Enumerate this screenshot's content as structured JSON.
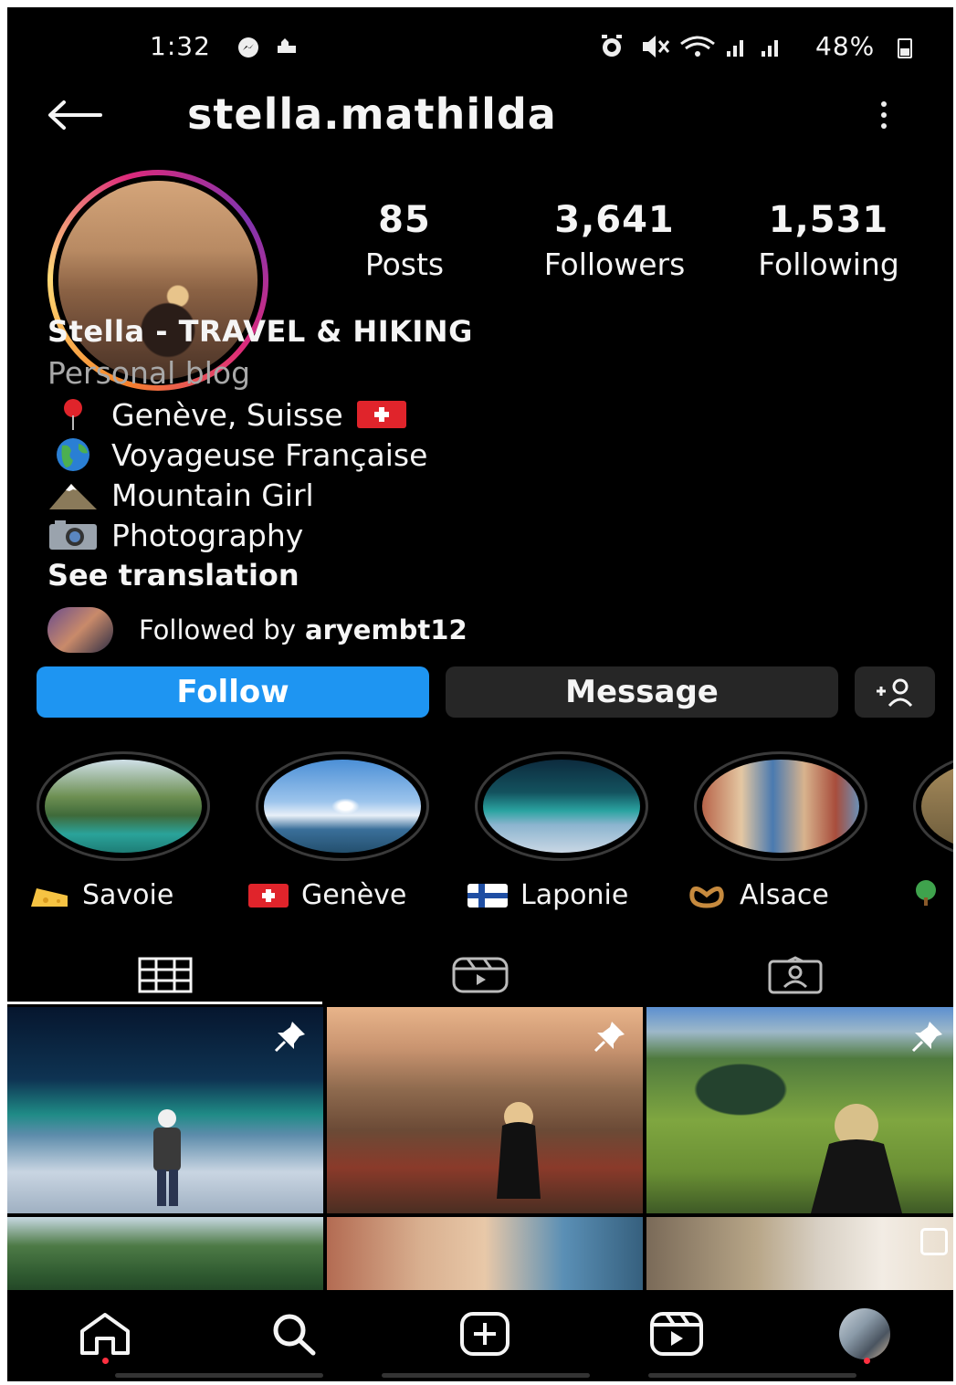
{
  "status_bar": {
    "time": "1:32",
    "battery": "48%",
    "icons": [
      "messenger-icon",
      "notification-icon",
      "alarm-icon",
      "mute-icon",
      "wifi-icon",
      "signal-icon",
      "signal-icon",
      "battery-icon"
    ]
  },
  "header": {
    "username": "stella.mathilda"
  },
  "stats": {
    "posts_count": "85",
    "posts_label": "Posts",
    "followers_count": "3,641",
    "followers_label": "Followers",
    "following_count": "1,531",
    "following_label": "Following"
  },
  "bio": {
    "name": "Stella - TRAVEL & HIKING",
    "category": "Personal blog",
    "lines": [
      {
        "text": "Genève, Suisse",
        "icon": "pin-emoji",
        "trailing_icon": "swiss-flag-emoji"
      },
      {
        "text": "Voyageuse Française",
        "icon": "globe-emoji"
      },
      {
        "text": "Mountain Girl",
        "icon": "mountain-emoji"
      },
      {
        "text": "Photography",
        "icon": "camera-emoji"
      }
    ],
    "see_translation": "See translation"
  },
  "followed_by": {
    "prefix": "Followed by",
    "user": "aryembt12"
  },
  "actions": {
    "follow": "Follow",
    "message": "Message",
    "accent": "#1e95f2"
  },
  "highlights": [
    {
      "label": "Savoie",
      "icon": "cheese-emoji"
    },
    {
      "label": "Genève",
      "icon": "swiss-flag-emoji"
    },
    {
      "label": "Laponie",
      "icon": "finland-flag-emoji"
    },
    {
      "label": "Alsace",
      "icon": "pretzel-emoji"
    },
    {
      "label": "",
      "icon": "tree-emoji"
    }
  ],
  "tabs": [
    "grid-icon",
    "reels-icon",
    "tagged-icon"
  ],
  "nav": [
    "home-icon",
    "search-icon",
    "new-post-icon",
    "reels-icon",
    "profile-avatar"
  ]
}
